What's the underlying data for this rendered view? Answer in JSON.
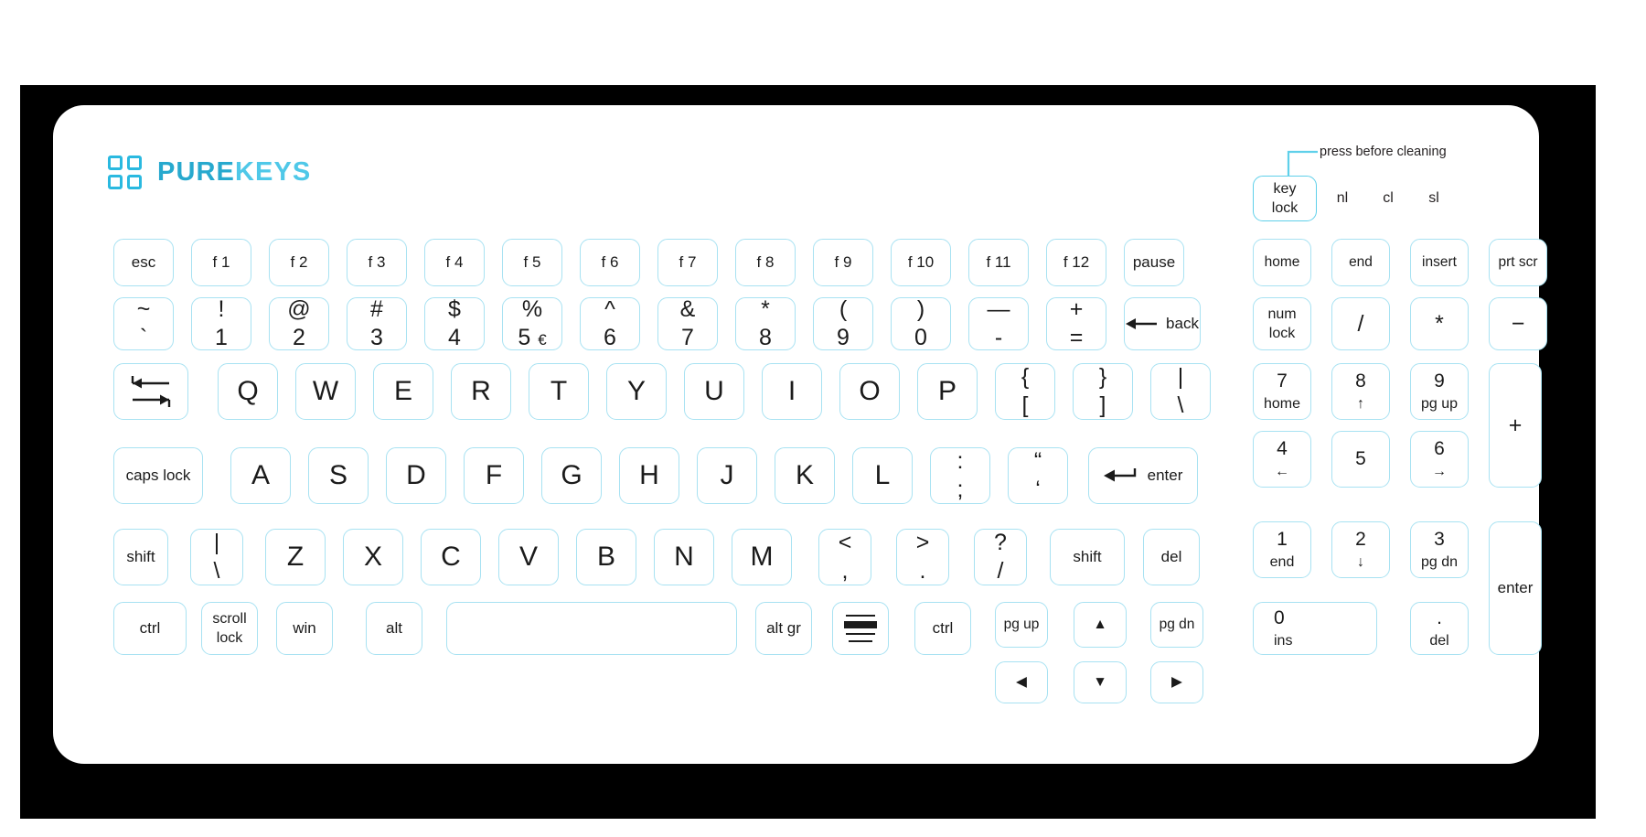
{
  "brand": {
    "part1": "PURE",
    "part2": "KEYS",
    "mark_icon": "four-squares-logo-icon"
  },
  "colors": {
    "accent": "#2ab9e0",
    "key_border": "#a8e2f2",
    "bezel": "#000000",
    "plate": "#ffffff",
    "legend": "#1b1b1b"
  },
  "annotation": {
    "text": "press before cleaning",
    "arrow_icon": "down-arrow-icon"
  },
  "indicators": [
    {
      "label": "nl",
      "name": "num-lock-indicator"
    },
    {
      "label": "cl",
      "name": "caps-lock-indicator"
    },
    {
      "label": "sl",
      "name": "scroll-lock-indicator"
    }
  ],
  "keylock": {
    "line1": "key",
    "line2": "lock"
  },
  "function_row": [
    {
      "label": "esc"
    },
    {
      "label": "f 1"
    },
    {
      "label": "f 2"
    },
    {
      "label": "f 3"
    },
    {
      "label": "f 4"
    },
    {
      "label": "f 5"
    },
    {
      "label": "f 6"
    },
    {
      "label": "f 7"
    },
    {
      "label": "f 8"
    },
    {
      "label": "f 9"
    },
    {
      "label": "f 10"
    },
    {
      "label": "f 11"
    },
    {
      "label": "f 12"
    },
    {
      "label": "pause"
    }
  ],
  "number_row": [
    {
      "up": "~",
      "lo": "`"
    },
    {
      "up": "!",
      "lo": "1"
    },
    {
      "up": "@",
      "lo": "2"
    },
    {
      "up": "#",
      "lo": "3"
    },
    {
      "up": "$",
      "lo": "4"
    },
    {
      "up": "%",
      "lo": "5",
      "extra": "€"
    },
    {
      "up": "^",
      "lo": "6"
    },
    {
      "up": "&",
      "lo": "7"
    },
    {
      "up": "*",
      "lo": "8"
    },
    {
      "up": "(",
      "lo": "9"
    },
    {
      "up": ")",
      "lo": "0"
    },
    {
      "up": "—",
      "lo": "-"
    },
    {
      "up": "+",
      "lo": "="
    }
  ],
  "backspace": {
    "label": "back",
    "icon": "left-arrow-icon"
  },
  "tab": {
    "icon": "tab-arrows-icon"
  },
  "qwerty_row": [
    {
      "label": "Q"
    },
    {
      "label": "W"
    },
    {
      "label": "E"
    },
    {
      "label": "R"
    },
    {
      "label": "T"
    },
    {
      "label": "Y"
    },
    {
      "label": "U"
    },
    {
      "label": "I"
    },
    {
      "label": "O"
    },
    {
      "label": "P"
    }
  ],
  "qwerty_tail": [
    {
      "up": "{",
      "lo": "["
    },
    {
      "up": "}",
      "lo": "]"
    },
    {
      "up": "|",
      "lo": "\\"
    }
  ],
  "caps_lock": {
    "label": "caps lock"
  },
  "home_row": [
    {
      "label": "A"
    },
    {
      "label": "S"
    },
    {
      "label": "D"
    },
    {
      "label": "F"
    },
    {
      "label": "G"
    },
    {
      "label": "H"
    },
    {
      "label": "J"
    },
    {
      "label": "K"
    },
    {
      "label": "L"
    }
  ],
  "home_tail": [
    {
      "up": ":",
      "lo": ";"
    },
    {
      "up": "“",
      "lo": "‘"
    }
  ],
  "enter": {
    "label": "enter",
    "icon": "enter-arrow-icon"
  },
  "shift_left": {
    "label": "shift"
  },
  "bslash_left": {
    "up": "|",
    "lo": "\\"
  },
  "zxcv_row": [
    {
      "label": "Z"
    },
    {
      "label": "X"
    },
    {
      "label": "C"
    },
    {
      "label": "V"
    },
    {
      "label": "B"
    },
    {
      "label": "N"
    },
    {
      "label": "M"
    }
  ],
  "zxcv_tail": [
    {
      "up": "<",
      "lo": ","
    },
    {
      "up": ">",
      "lo": "."
    },
    {
      "up": "?",
      "lo": "/"
    }
  ],
  "shift_right": {
    "label": "shift"
  },
  "del": {
    "label": "del"
  },
  "bottom_row": [
    {
      "label": "ctrl",
      "name": "key-ctrl-left"
    },
    {
      "line1": "scroll",
      "line2": "lock",
      "name": "key-scroll-lock"
    },
    {
      "label": "win",
      "name": "key-win"
    },
    {
      "label": "alt",
      "name": "key-alt"
    },
    {
      "label": "",
      "name": "key-space"
    },
    {
      "label": "alt gr",
      "name": "key-alt-gr"
    },
    {
      "label": "",
      "name": "key-menu",
      "icon": "menu-lines-icon"
    },
    {
      "label": "ctrl",
      "name": "key-ctrl-right"
    }
  ],
  "nav_cluster": [
    {
      "label": "pg up",
      "name": "key-page-up"
    },
    {
      "label": "▲",
      "name": "key-arrow-up"
    },
    {
      "label": "pg dn",
      "name": "key-page-down"
    },
    {
      "label": "◀",
      "name": "key-arrow-left"
    },
    {
      "label": "▼",
      "name": "key-arrow-down"
    },
    {
      "label": "▶",
      "name": "key-arrow-right"
    }
  ],
  "edit_cluster": [
    {
      "label": "home",
      "name": "key-home"
    },
    {
      "label": "end",
      "name": "key-end"
    },
    {
      "label": "insert",
      "name": "key-insert"
    },
    {
      "label": "prt scr",
      "name": "key-print-screen"
    }
  ],
  "numpad_top": [
    {
      "line1": "num",
      "line2": "lock",
      "name": "key-num-lock"
    },
    {
      "label": "/",
      "name": "key-numpad-divide"
    },
    {
      "label": "*",
      "name": "key-numpad-multiply"
    },
    {
      "label": "−",
      "name": "key-numpad-minus"
    }
  ],
  "numpad": [
    {
      "up": "7",
      "lo": "home",
      "name": "key-numpad-7"
    },
    {
      "up": "8",
      "lo": "↑",
      "name": "key-numpad-8"
    },
    {
      "up": "9",
      "lo": "pg up",
      "name": "key-numpad-9"
    },
    {
      "up": "4",
      "lo": "←",
      "name": "key-numpad-4"
    },
    {
      "up": "5",
      "lo": "",
      "name": "key-numpad-5"
    },
    {
      "up": "6",
      "lo": "→",
      "name": "key-numpad-6"
    },
    {
      "up": "1",
      "lo": "end",
      "name": "key-numpad-1"
    },
    {
      "up": "2",
      "lo": "↓",
      "name": "key-numpad-2"
    },
    {
      "up": "3",
      "lo": "pg dn",
      "name": "key-numpad-3"
    },
    {
      "up": "0",
      "lo": "ins",
      "name": "key-numpad-0"
    },
    {
      "up": ".",
      "lo": "del",
      "name": "key-numpad-decimal"
    }
  ],
  "numpad_plus": {
    "label": "+"
  },
  "numpad_enter": {
    "label": "enter"
  }
}
